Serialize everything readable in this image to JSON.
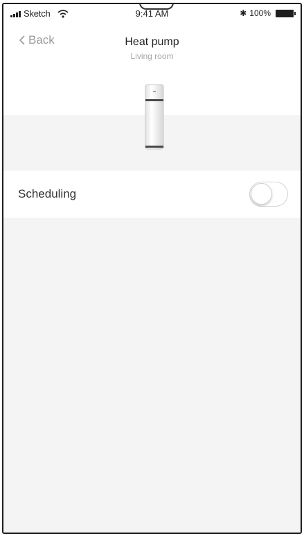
{
  "status_bar": {
    "carrier": "Sketch",
    "time": "9:41 AM",
    "battery_text": "100%",
    "bluetooth_icon": "bluetooth-icon",
    "wifi_icon": "wifi-icon",
    "signal_icon": "signal-icon",
    "battery_icon": "battery-icon"
  },
  "nav": {
    "back_label": "Back",
    "back_icon": "chevron-left-icon",
    "title": "Heat pump",
    "subtitle": "Living room"
  },
  "device": {
    "icon": "heat-pump-device-icon"
  },
  "settings": {
    "scheduling_label": "Scheduling",
    "scheduling_enabled": false
  },
  "colors": {
    "background": "#f4f4f4",
    "surface": "#ffffff",
    "muted_text": "#9a9a9a",
    "primary_text": "#222222"
  }
}
